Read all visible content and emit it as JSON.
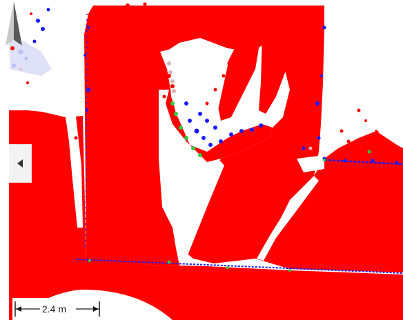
{
  "viewer": {
    "scale_label": "2.4 m",
    "colors": {
      "point_red": "#ff0000",
      "point_blue": "#1a1aff",
      "point_green": "#2ecc40",
      "grid_green": "#b7f0b7",
      "background": "#ffffff"
    },
    "icons": {
      "collapse": "triangle-left-icon",
      "compass": "north-arrow-icon"
    }
  }
}
